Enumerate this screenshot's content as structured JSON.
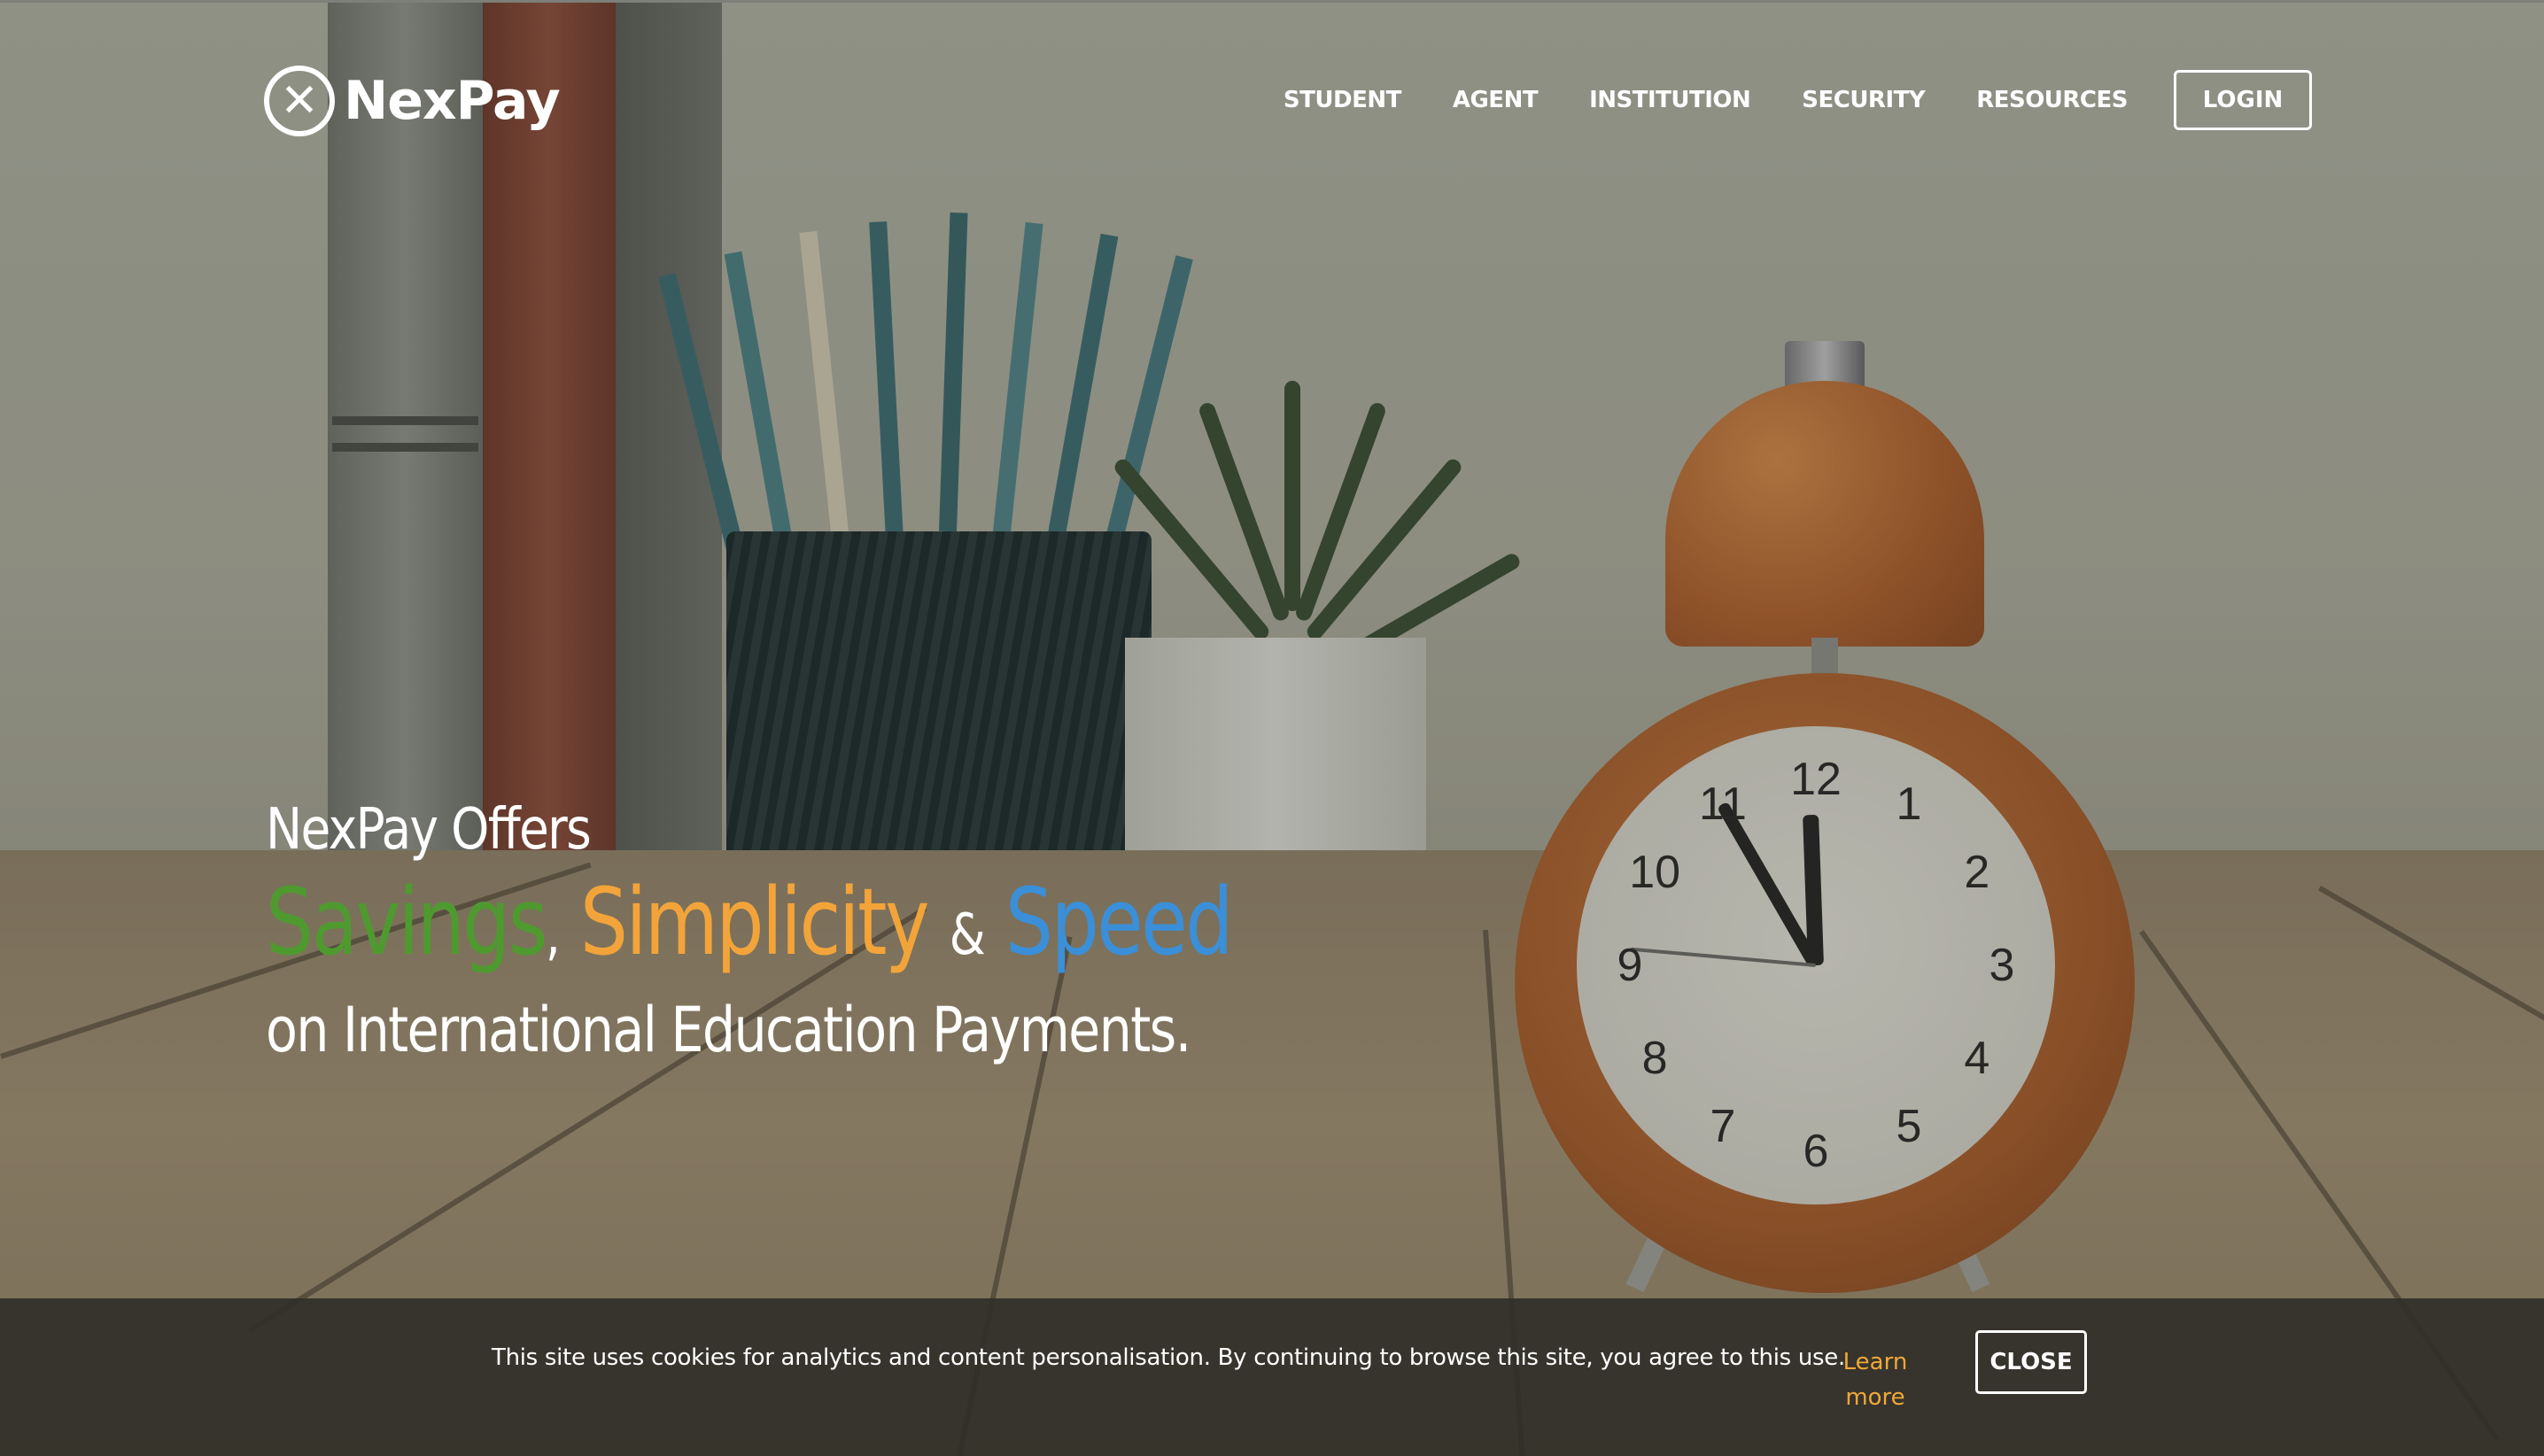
{
  "brand": {
    "name": "NexPay",
    "logo_icon": "network-x-icon"
  },
  "nav": {
    "items": [
      {
        "label": "STUDENT"
      },
      {
        "label": "AGENT"
      },
      {
        "label": "INSTITUTION"
      },
      {
        "label": "SECURITY"
      },
      {
        "label": "RESOURCES"
      }
    ],
    "login_label": "LOGIN"
  },
  "hero": {
    "line1": "NexPay Offers",
    "word1": "Savings",
    "comma": ",",
    "word2": "Simplicity",
    "amp": "&",
    "word3": "Speed",
    "line3": "on International Education Payments.",
    "colors": {
      "savings": "#4e9a2f",
      "simplicity": "#f2a43a",
      "speed": "#3a8fd8"
    }
  },
  "clock": {
    "numbers": [
      "12",
      "1",
      "2",
      "3",
      "4",
      "5",
      "6",
      "7",
      "8",
      "9",
      "10",
      "11"
    ]
  },
  "cookie": {
    "message": "This site uses cookies for analytics and content personalisation. By continuing to browse this site, you agree to this use.",
    "learn_more": "Learn more",
    "close_label": "CLOSE"
  }
}
